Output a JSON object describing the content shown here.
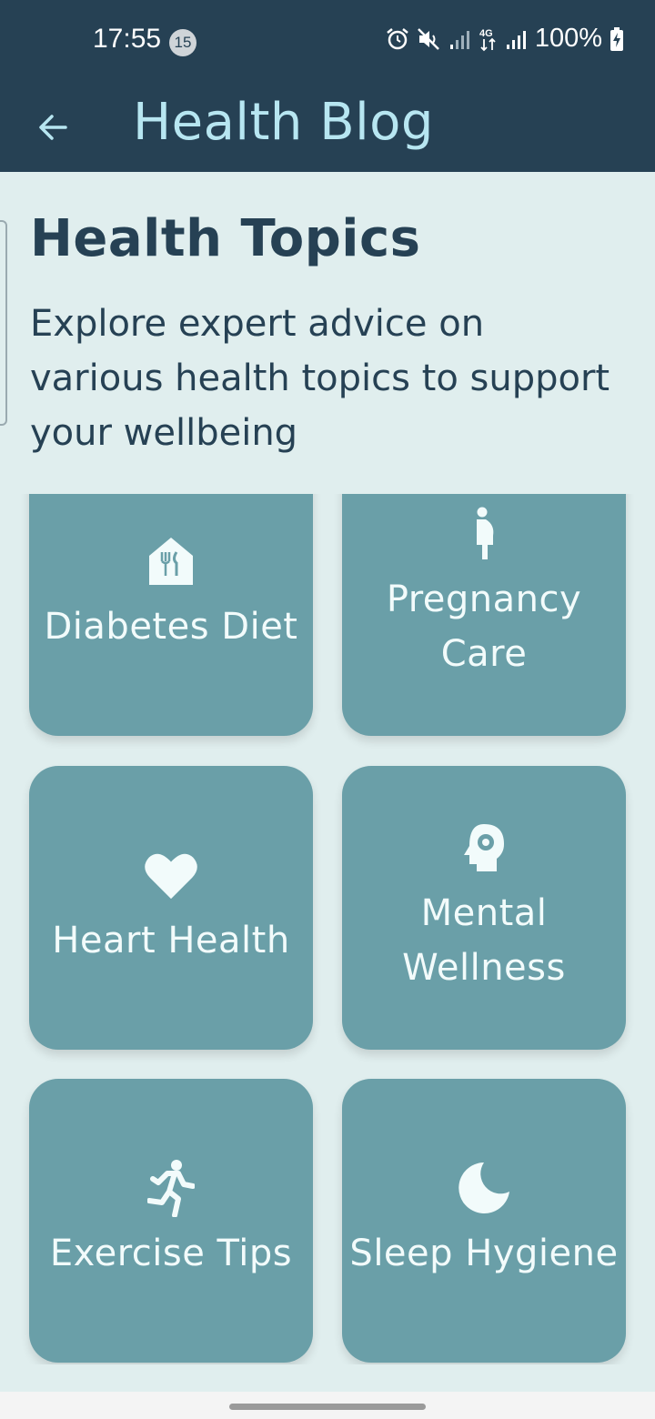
{
  "status_bar": {
    "time": "17:55",
    "notification_count": "15",
    "battery": "100%",
    "icons": [
      "alarm-icon",
      "mute-icon",
      "signal-icon",
      "4g-data-icon",
      "signal-icon",
      "battery-charging-icon"
    ]
  },
  "app_bar": {
    "back_icon": "arrow-left-icon",
    "title": "Health Blog"
  },
  "page": {
    "heading": "Health Topics",
    "description": "Explore expert advice on various health topics to support your wellbeing"
  },
  "topics": [
    {
      "label": "Diabetes Diet",
      "icon": "restaurant-icon"
    },
    {
      "label": "Pregnancy Care",
      "icon": "pregnant-woman-icon"
    },
    {
      "label": "Heart Health",
      "icon": "heart-icon"
    },
    {
      "label": "Mental Wellness",
      "icon": "psychology-icon"
    },
    {
      "label": "Exercise Tips",
      "icon": "running-icon"
    },
    {
      "label": "Sleep Hygiene",
      "icon": "moon-icon"
    }
  ],
  "colors": {
    "app_bar": "#264154",
    "title_text": "#b7e6f1",
    "background": "#e0eeee",
    "card": "#6a9fa8",
    "card_text": "#f2fbfb",
    "heading_text": "#264154"
  }
}
